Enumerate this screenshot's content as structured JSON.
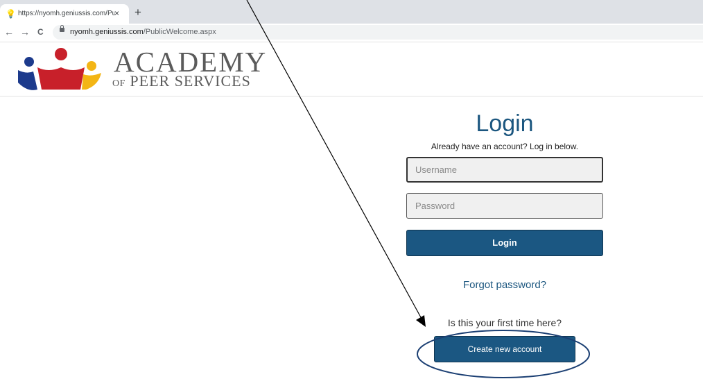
{
  "browser": {
    "tab_title": "https://nyomh.geniussis.com/Pu",
    "tab_favicon": "lightbulb-icon",
    "tab_close": "×",
    "new_tab": "+",
    "nav": {
      "back": "←",
      "forward": "→",
      "reload": "C"
    },
    "url_host": "nyomh.geniussis.com",
    "url_path": "/PublicWelcome.aspx"
  },
  "header": {
    "logo_main": "ACADEMY",
    "logo_of": "OF",
    "logo_sub": "PEER SERVICES",
    "logo_colors": {
      "navy": "#1c3a8c",
      "red": "#c8202a",
      "gold": "#f3b515"
    }
  },
  "login": {
    "title": "Login",
    "subtitle": "Already have an account? Log in below.",
    "username_placeholder": "Username",
    "username_value": "",
    "password_placeholder": "Password",
    "password_value": "",
    "login_button": "Login",
    "forgot_link": "Forgot password?",
    "first_time_text": "Is this your first time here?",
    "create_button": "Create new account"
  },
  "colors": {
    "accent": "#1b5782",
    "title": "#1b567f"
  }
}
